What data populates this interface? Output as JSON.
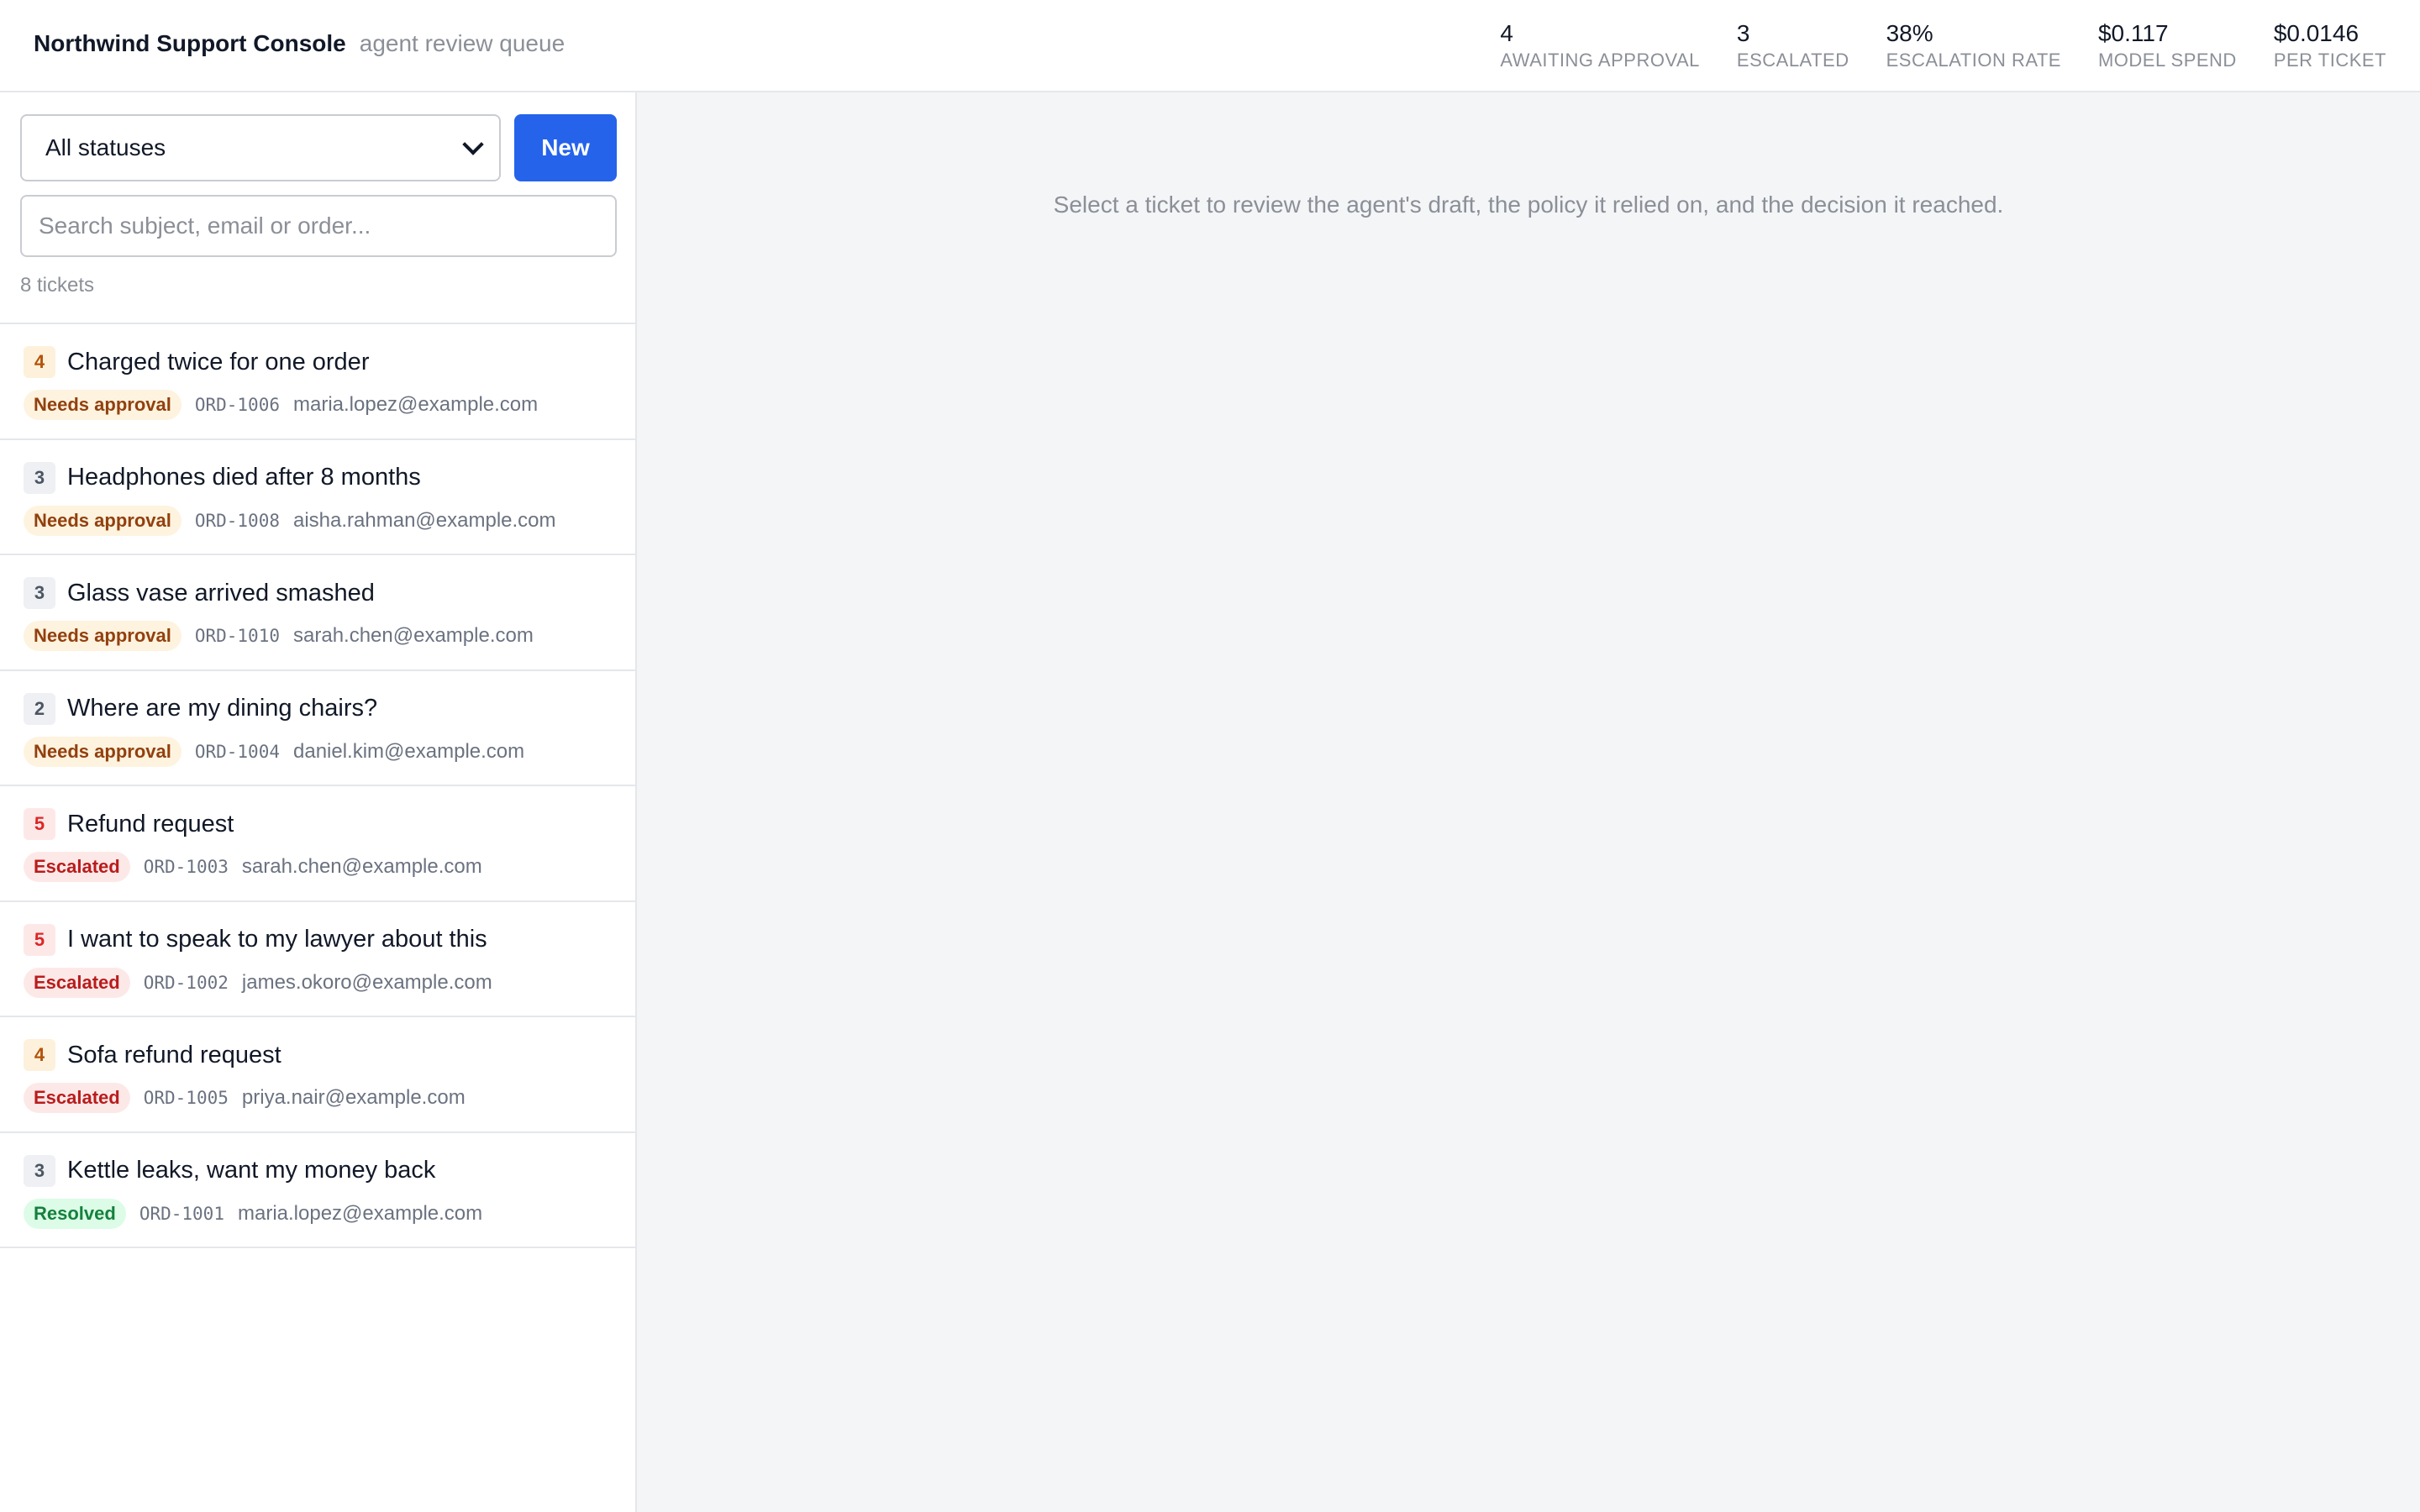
{
  "header": {
    "title": "Northwind Support Console",
    "subtitle": "agent review queue",
    "stats": [
      {
        "value": "4",
        "label": "AWAITING APPROVAL"
      },
      {
        "value": "3",
        "label": "ESCALATED"
      },
      {
        "value": "38%",
        "label": "ESCALATION RATE"
      },
      {
        "value": "$0.117",
        "label": "MODEL SPEND"
      },
      {
        "value": "$0.0146",
        "label": "PER TICKET"
      }
    ]
  },
  "sidebar": {
    "status_filter": "All statuses",
    "new_label": "New",
    "search_placeholder": "Search subject, email or order...",
    "ticket_count": "8 tickets",
    "tickets": [
      {
        "priority": "4",
        "subject": "Charged twice for one order",
        "status": "Needs approval",
        "order": "ORD-1006",
        "email": "maria.lopez@example.com"
      },
      {
        "priority": "3",
        "subject": "Headphones died after 8 months",
        "status": "Needs approval",
        "order": "ORD-1008",
        "email": "aisha.rahman@example.com"
      },
      {
        "priority": "3",
        "subject": "Glass vase arrived smashed",
        "status": "Needs approval",
        "order": "ORD-1010",
        "email": "sarah.chen@example.com"
      },
      {
        "priority": "2",
        "subject": "Where are my dining chairs?",
        "status": "Needs approval",
        "order": "ORD-1004",
        "email": "daniel.kim@example.com"
      },
      {
        "priority": "5",
        "subject": "Refund request",
        "status": "Escalated",
        "order": "ORD-1003",
        "email": "sarah.chen@example.com"
      },
      {
        "priority": "5",
        "subject": "I want to speak to my lawyer about this",
        "status": "Escalated",
        "order": "ORD-1002",
        "email": "james.okoro@example.com"
      },
      {
        "priority": "4",
        "subject": "Sofa refund request",
        "status": "Escalated",
        "order": "ORD-1005",
        "email": "priya.nair@example.com"
      },
      {
        "priority": "3",
        "subject": "Kettle leaks, want my money back",
        "status": "Resolved",
        "order": "ORD-1001",
        "email": "maria.lopez@example.com"
      }
    ]
  },
  "main": {
    "empty_message": "Select a ticket to review the agent's draft, the policy it relied on, and the decision it reached."
  }
}
